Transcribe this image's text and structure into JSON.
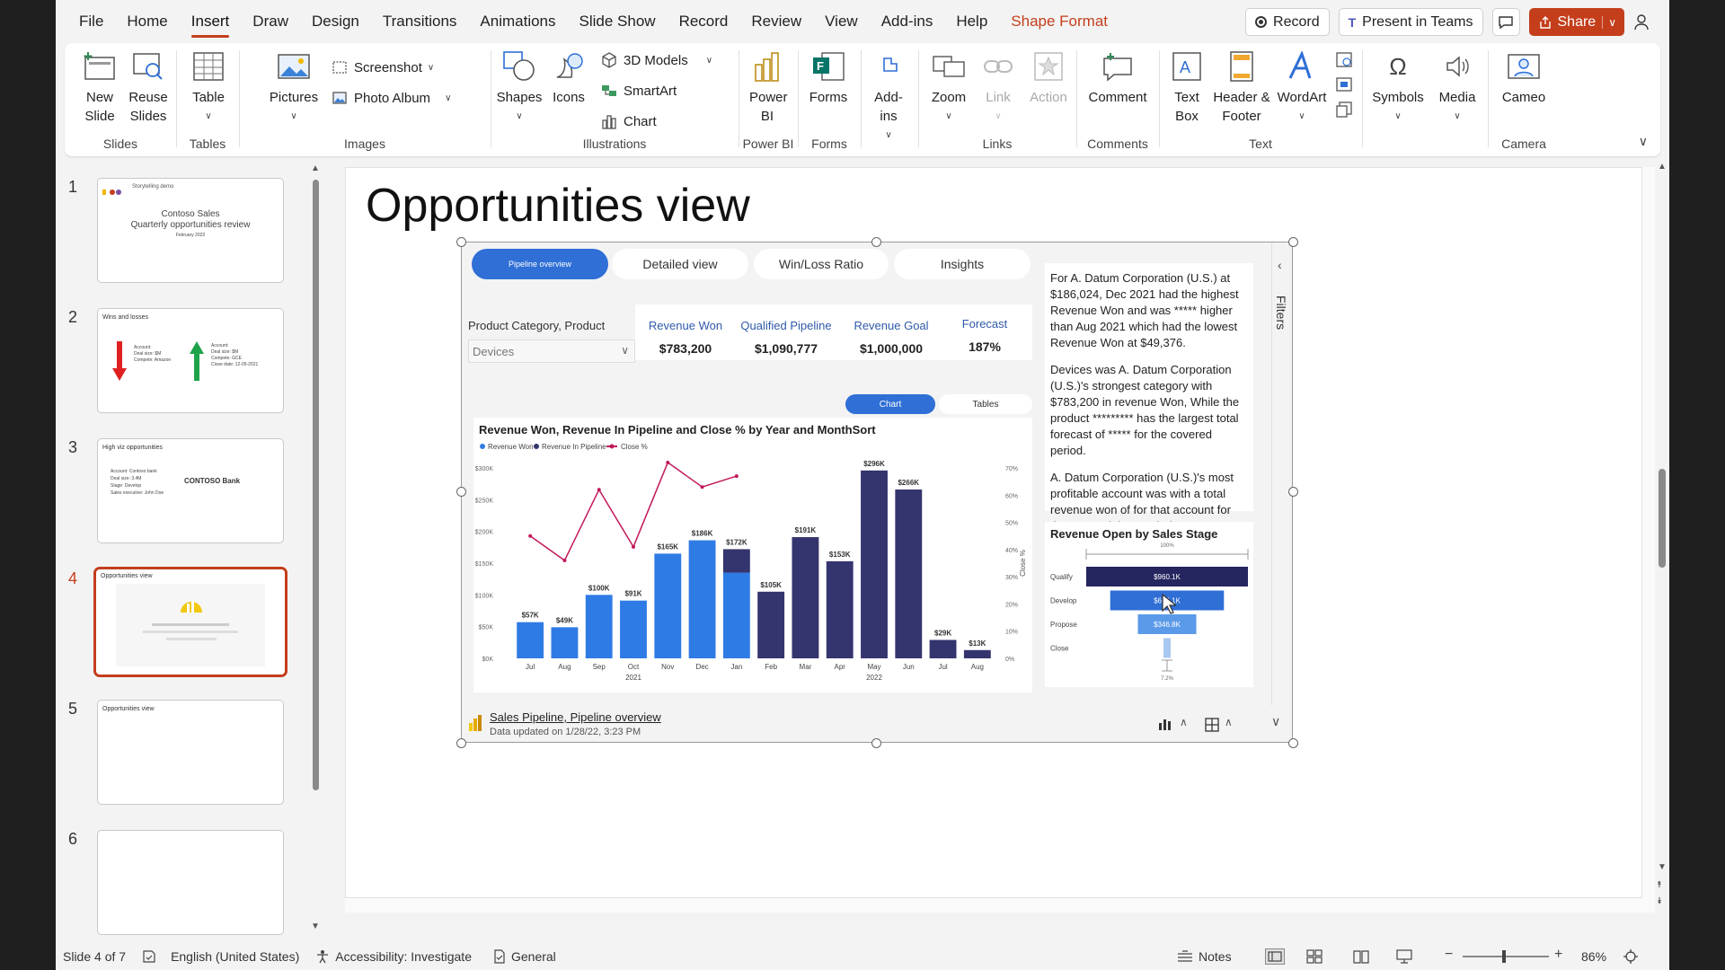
{
  "menu": {
    "tabs": [
      "File",
      "Home",
      "Insert",
      "Draw",
      "Design",
      "Transitions",
      "Animations",
      "Slide Show",
      "Record",
      "Review",
      "View",
      "Add-ins",
      "Help",
      "Shape Format"
    ],
    "active": "Insert",
    "record_label": "Record",
    "present_label": "Present in Teams",
    "share_label": "Share"
  },
  "ribbon": {
    "slides": {
      "new_slide": "New Slide",
      "reuse_slides": "Reuse Slides",
      "label": "Slides"
    },
    "tables": {
      "table": "Table",
      "label": "Tables"
    },
    "images": {
      "pictures": "Pictures",
      "screenshot": "Screenshot",
      "photo_album": "Photo Album",
      "label": "Images"
    },
    "illustrations": {
      "shapes": "Shapes",
      "icons": "Icons",
      "models": "3D Models",
      "smartart": "SmartArt",
      "chart": "Chart",
      "label": "Illustrations"
    },
    "powerbi": {
      "btn": "Power BI",
      "label": "Power BI"
    },
    "forms": {
      "btn": "Forms",
      "label": "Forms"
    },
    "addins": {
      "btn": "Add-ins"
    },
    "links": {
      "zoom": "Zoom",
      "link": "Link",
      "action": "Action",
      "label": "Links"
    },
    "comments": {
      "btn": "Comment",
      "label": "Comments"
    },
    "text": {
      "textbox": "Text Box",
      "header": "Header & Footer",
      "wordart": "WordArt",
      "label": "Text"
    },
    "symbols": {
      "btn": "Symbols"
    },
    "media": {
      "btn": "Media"
    },
    "camera": {
      "btn": "Cameo",
      "label": "Camera"
    }
  },
  "thumbnails": [
    {
      "num": "1",
      "subtitle": "Storytelling demo",
      "title1": "Contoso Sales",
      "title2": "Quarterly opportunities review",
      "date": "February 2022"
    },
    {
      "num": "2",
      "title": "Wins and losses",
      "a_lines": [
        "Account:",
        "Deal size: $M",
        "Compete: Amazon"
      ],
      "b_lines": [
        "Account:",
        "Deal size: $M",
        "Compete: GCE",
        "Close date: 12-05-2021"
      ]
    },
    {
      "num": "3",
      "title": "High viz opportunities",
      "lines": [
        "Account: Contoso bank",
        "Deal size: 3.4M",
        "Stage: Develop",
        "Sales executive: John Doe"
      ],
      "logo": "CONTOSO Bank"
    },
    {
      "num": "4",
      "title": "Opportunities view"
    },
    {
      "num": "5",
      "title": "Opportunities view"
    },
    {
      "num": "6",
      "title": ""
    }
  ],
  "slide": {
    "title": "Opportunities view"
  },
  "report": {
    "tabs": [
      "Pipeline overview",
      "Detailed view",
      "Win/Loss Ratio",
      "Insights"
    ],
    "filter_label": "Product Category, Product",
    "filter_value": "Devices",
    "kpis": [
      {
        "label": "Revenue Won",
        "value": "$783,200"
      },
      {
        "label": "Qualified Pipeline",
        "value": "$1,090,777"
      },
      {
        "label": "Revenue Goal",
        "value": "$1,000,000"
      },
      {
        "label": "Forecast",
        "value": "187%"
      }
    ],
    "toggle_chart": "Chart",
    "toggle_tables": "Tables",
    "insights": [
      "For A. Datum Corporation  (U.S.)  at $186,024, Dec 2021 had the highest Revenue Won and was ***** higher than Aug 2021 which had the lowest Revenue Won at  $49,376.",
      "Devices was A. Datum Corporation  (U.S.)'s strongest category with $783,200 in revenue Won, While the product ********* has the largest total forecast of ***** for the covered period.",
      "A. Datum Corporation  (U.S.)'s most profitable account was with a total revenue won of for that account for the covered time period."
    ],
    "footer_title": "Sales Pipeline, Pipeline overview",
    "footer_updated": "Data updated on 1/28/22, 3:23 PM",
    "filters_label": "Filters"
  },
  "chart_data": [
    {
      "type": "bar",
      "title": "Revenue Won, Revenue In Pipeline and Close % by Year and MonthSort",
      "legend": [
        "Revenue Won",
        "Revenue In Pipeline",
        "Close %"
      ],
      "categories": [
        "Jul",
        "Aug",
        "Sep",
        "Oct",
        "Nov",
        "Dec",
        "Jan",
        "Feb",
        "Mar",
        "Apr",
        "May",
        "Jun",
        "Jul",
        "Aug"
      ],
      "years": [
        {
          "label": "2021"
        },
        {
          "label": "2022"
        }
      ],
      "data_labels": [
        "$57K",
        "$49K",
        "$100K",
        "$91K",
        "$165K",
        "$186K",
        "$172K",
        "$105K",
        "$191K",
        "$153K",
        "$296K",
        "$266K",
        "$29K",
        "$13K"
      ],
      "series": [
        {
          "name": "Revenue Won",
          "color": "#2f7be5",
          "values": [
            57,
            49,
            100,
            91,
            165,
            186,
            135,
            0,
            0,
            0,
            0,
            0,
            0,
            0
          ]
        },
        {
          "name": "Revenue In Pipeline",
          "color": "#34346e",
          "values": [
            0,
            0,
            0,
            0,
            0,
            0,
            37,
            105,
            191,
            153,
            296,
            266,
            29,
            13
          ]
        },
        {
          "name": "Close %",
          "color": "#c2185b",
          "values": [
            45,
            36,
            62,
            41,
            72,
            63,
            67,
            null,
            null,
            null,
            null,
            null,
            null,
            null
          ]
        }
      ],
      "y_ticks": [
        "$0K",
        "$50K",
        "$100K",
        "$150K",
        "$200K",
        "$250K",
        "$300K"
      ],
      "y_right_ticks": [
        "0%",
        "10%",
        "20%",
        "30%",
        "40%",
        "50%",
        "60%",
        "70%"
      ],
      "y_right_label": "Close %",
      "ylim": [
        0,
        300
      ],
      "y2lim": [
        0,
        70
      ]
    },
    {
      "type": "bar",
      "title": "Revenue Open by Sales Stage",
      "categories": [
        "Qualify",
        "Develop",
        "Propose",
        "Close"
      ],
      "values": [
        960.1,
        675.1,
        346.8,
        25
      ],
      "labels": [
        "$960.1K",
        "$675.1K",
        "$346.8K",
        ""
      ],
      "top_label": "100%",
      "bottom_label": "7.2%",
      "colors": [
        "#252560",
        "#2f6fd6",
        "#5b9ae8",
        "#a9c8f2"
      ]
    }
  ],
  "statusbar": {
    "slide": "Slide 4 of 7",
    "language": "English (United States)",
    "accessibility": "Accessibility: Investigate",
    "sensitivity": "General",
    "notes": "Notes",
    "zoom": "86%"
  }
}
